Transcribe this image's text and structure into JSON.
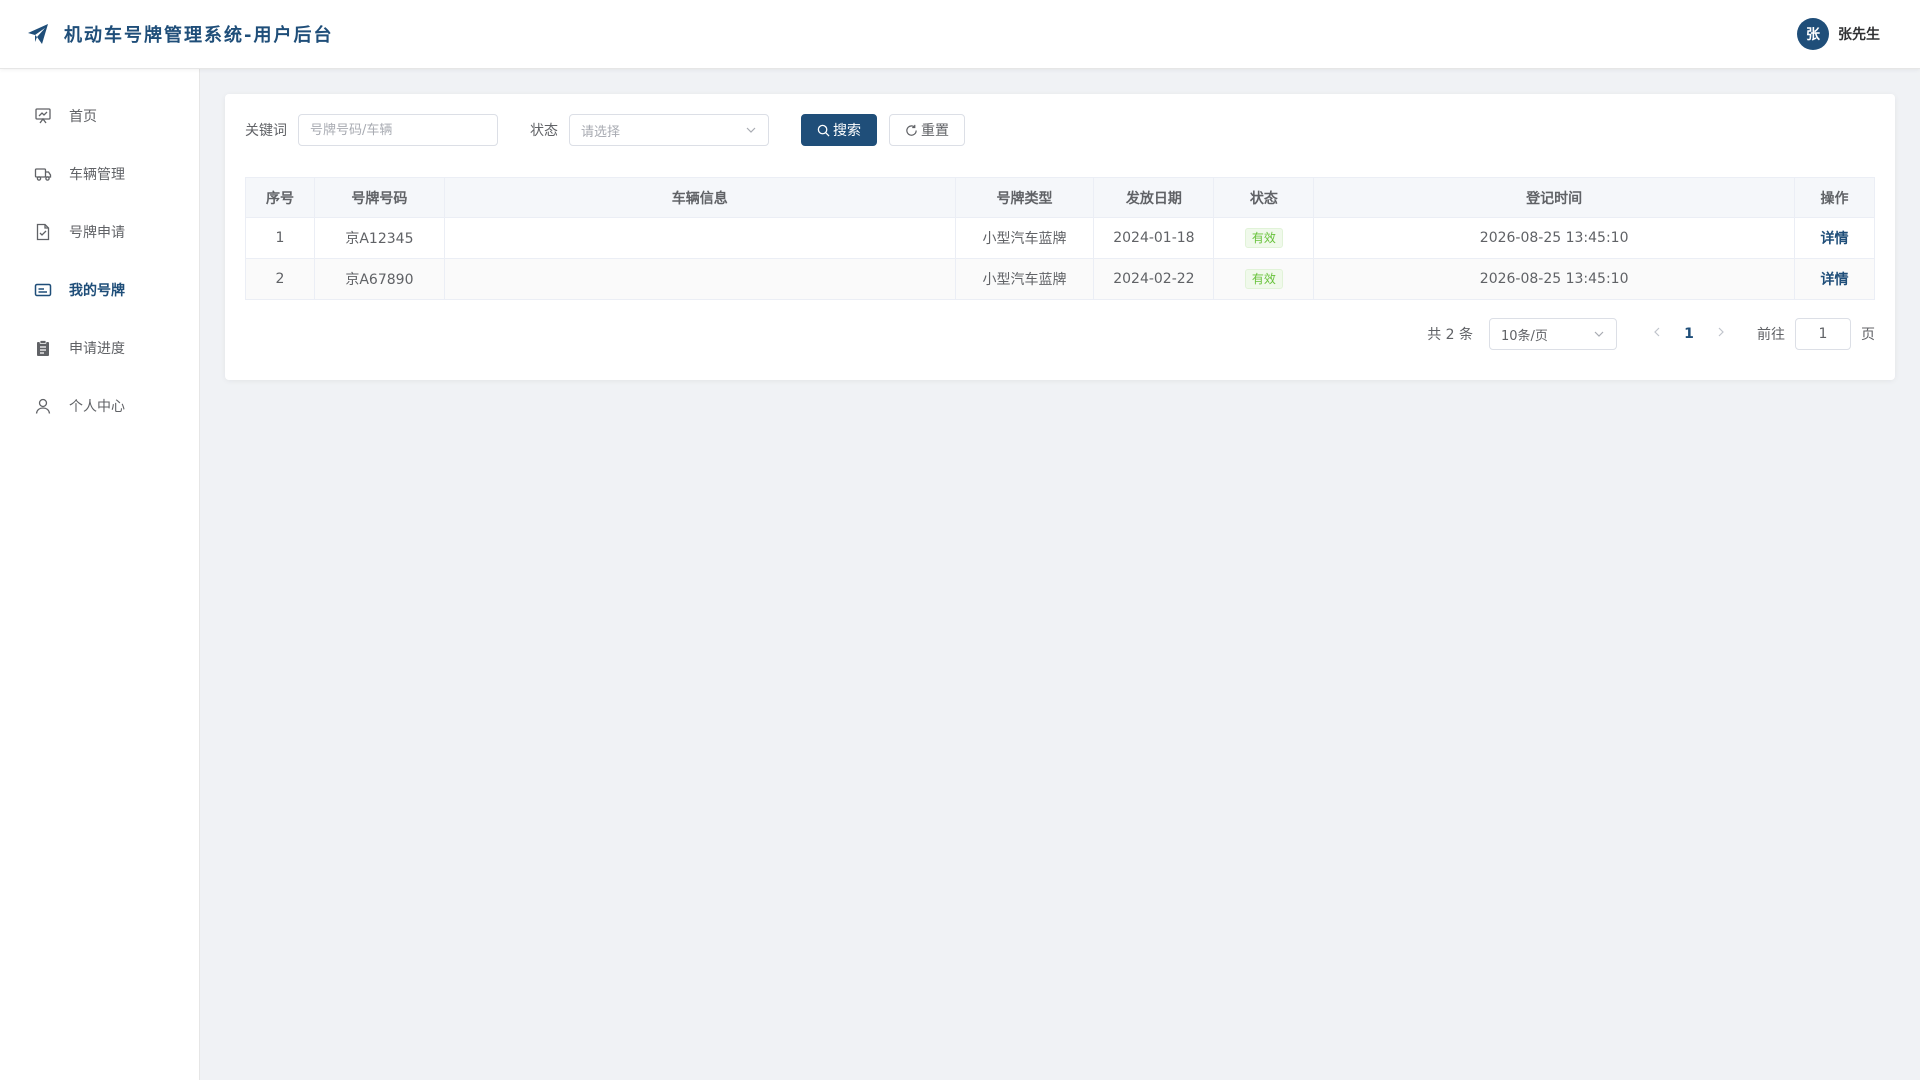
{
  "header": {
    "title": "机动车号牌管理系统-用户后台",
    "user_avatar": "张",
    "user_name": "张先生"
  },
  "sidebar": {
    "items": [
      {
        "label": "首页",
        "icon": "chart-icon"
      },
      {
        "label": "车辆管理",
        "icon": "truck-icon"
      },
      {
        "label": "号牌申请",
        "icon": "document-check-icon"
      },
      {
        "label": "我的号牌",
        "icon": "card-icon"
      },
      {
        "label": "申请进度",
        "icon": "clipboard-icon"
      },
      {
        "label": "个人中心",
        "icon": "user-icon"
      }
    ],
    "active_index": 3
  },
  "search": {
    "keyword_label": "关键词",
    "keyword_placeholder": "号牌号码/车辆",
    "status_label": "状态",
    "status_placeholder": "请选择",
    "search_button": "搜索",
    "reset_button": "重置"
  },
  "table": {
    "columns": [
      "序号",
      "号牌号码",
      "车辆信息",
      "号牌类型",
      "发放日期",
      "状态",
      "登记时间",
      "操作"
    ],
    "rows": [
      {
        "index": "1",
        "plate": "京A12345",
        "vehicle": "",
        "type": "小型汽车蓝牌",
        "date": "2024-01-18",
        "status": "有效",
        "registered": "2026-08-25 13:45:10",
        "action": "详情"
      },
      {
        "index": "2",
        "plate": "京A67890",
        "vehicle": "",
        "type": "小型汽车蓝牌",
        "date": "2024-02-22",
        "status": "有效",
        "registered": "2026-08-25 13:45:10",
        "action": "详情"
      }
    ]
  },
  "pagination": {
    "total": "共 2 条",
    "page_size": "10条/页",
    "current_page": "1",
    "goto_label": "前往",
    "goto_value": "1",
    "page_suffix": "页"
  },
  "colors": {
    "primary": "#1f4e79",
    "success": "#67c23a"
  }
}
